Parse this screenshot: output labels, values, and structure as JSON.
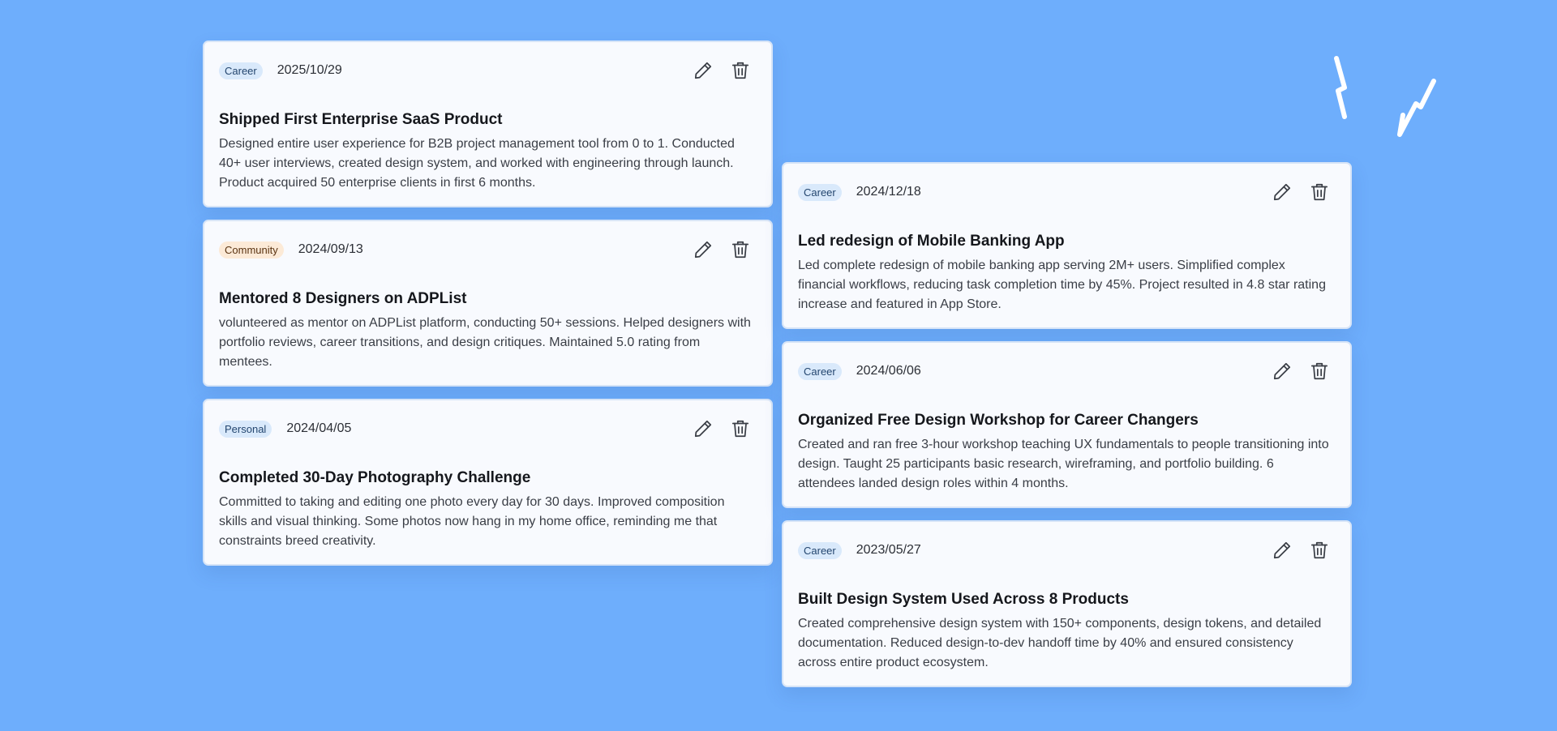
{
  "accent_colors": {
    "background": "#6eaefc",
    "card": "#f8fafe",
    "badge_career": "#d9e9fb",
    "badge_community": "#fcead7"
  },
  "icons": {
    "edit": "pencil-icon",
    "delete": "trash-icon",
    "decoration": "squiggle-icon"
  },
  "left_cards": [
    {
      "tag": "Career",
      "date": "2025/10/29",
      "title": "Shipped First Enterprise SaaS Product",
      "description": "Designed entire user experience for B2B project management tool from 0 to 1. Conducted 40+ user interviews, created design system, and worked with engineering through launch. Product acquired 50 enterprise clients in first 6 months."
    },
    {
      "tag": "Community",
      "date": "2024/09/13",
      "title": "Mentored 8 Designers on ADPList",
      "description": "volunteered as mentor on ADPList platform, conducting 50+ sessions. Helped designers with portfolio reviews, career transitions, and design critiques. Maintained 5.0 rating from mentees."
    },
    {
      "tag": "Personal",
      "date": "2024/04/05",
      "title": "Completed 30-Day Photography Challenge",
      "description": "Committed to taking and editing one photo every day for 30 days. Improved composition skills and visual thinking. Some photos now hang in my home office, reminding me that constraints breed creativity."
    }
  ],
  "right_cards": [
    {
      "tag": "Career",
      "date": "2024/12/18",
      "title": "Led redesign of Mobile Banking App",
      "description": "Led complete redesign of mobile banking app serving 2M+ users. Simplified complex financial workflows, reducing task completion time by 45%. Project resulted in 4.8 star rating increase and featured in App Store."
    },
    {
      "tag": "Career",
      "date": "2024/06/06",
      "title": "Organized Free Design Workshop for Career Changers",
      "description": "Created and ran free 3-hour workshop teaching UX fundamentals to people transitioning into design. Taught 25 participants basic research, wireframing, and portfolio building. 6 attendees landed design roles within 4 months."
    },
    {
      "tag": "Career",
      "date": "2023/05/27",
      "title": "Built Design System Used Across 8 Products",
      "description": "Created comprehensive design system with 150+ components, design tokens, and detailed documentation. Reduced design-to-dev handoff time by 40% and ensured consistency across entire product ecosystem."
    }
  ]
}
